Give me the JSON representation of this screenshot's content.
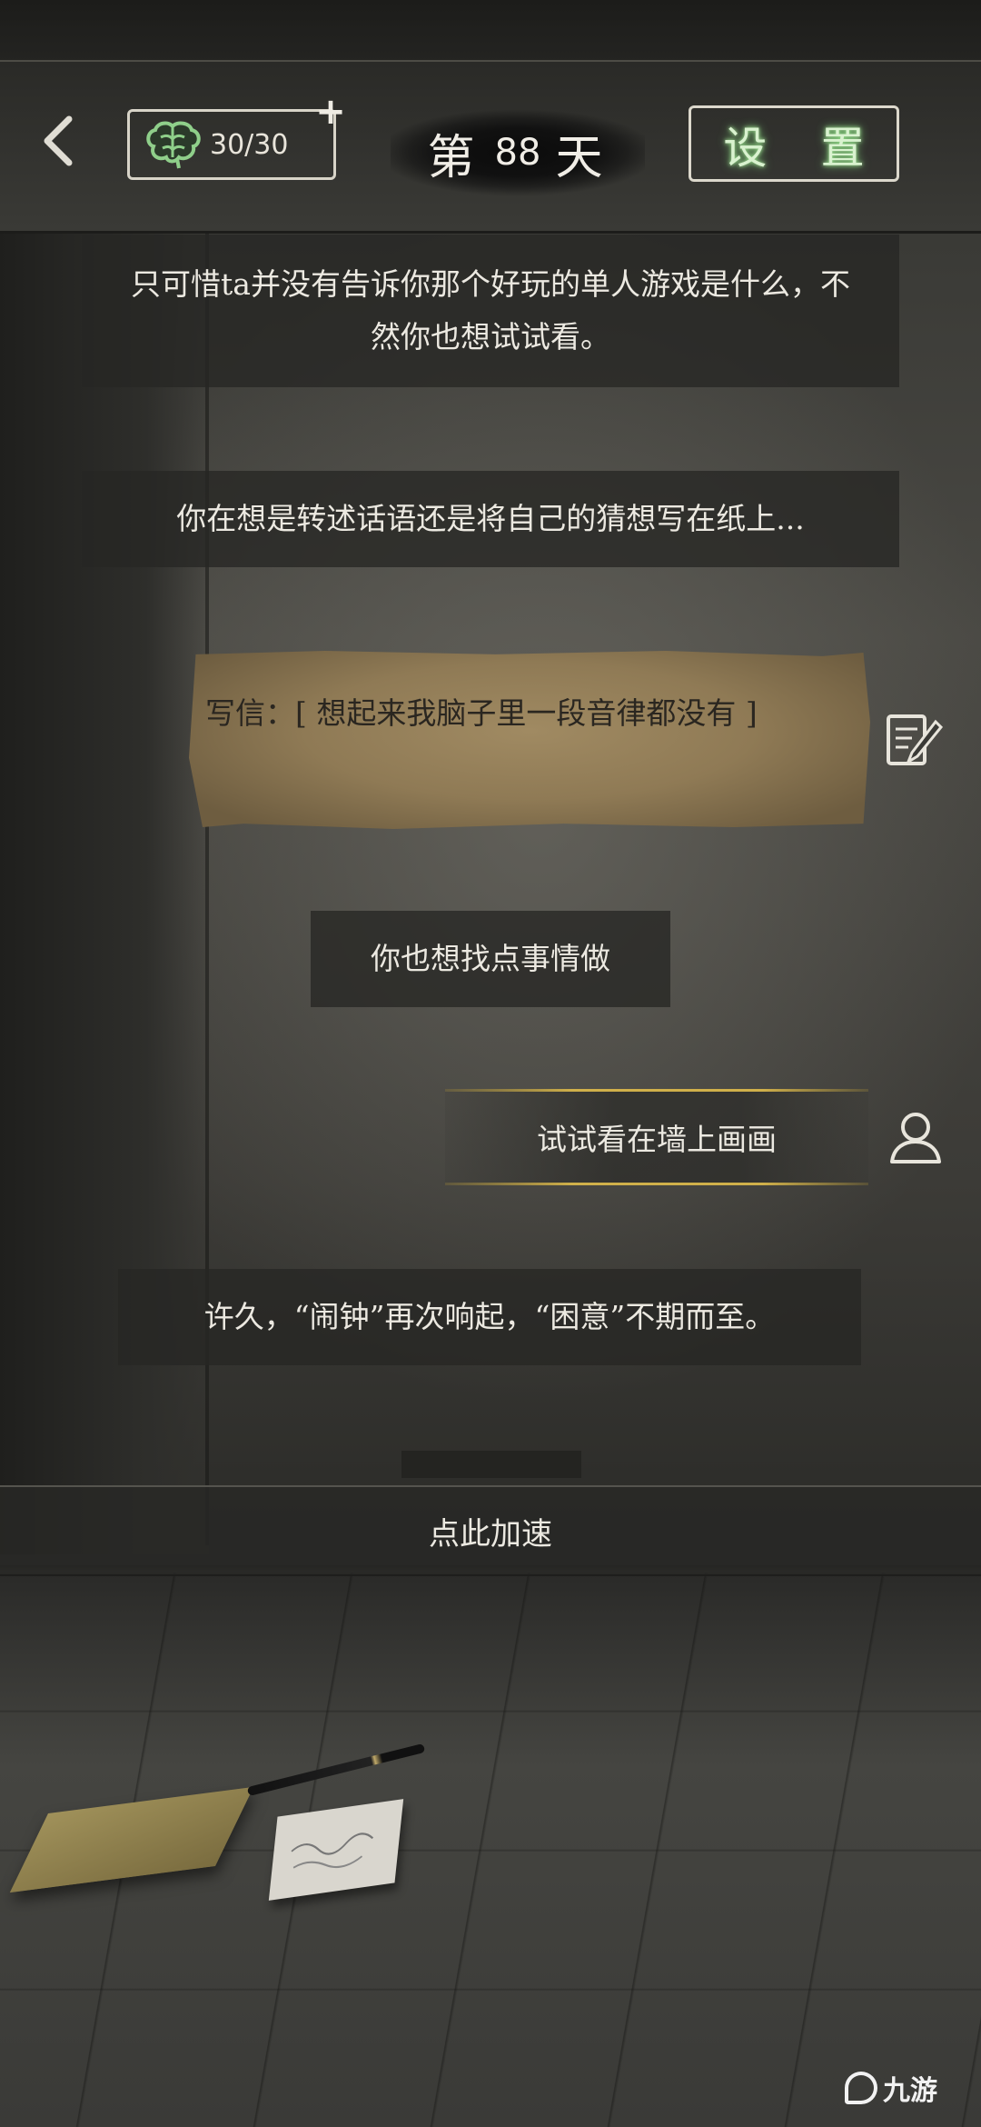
{
  "header": {
    "brain_count": "30/30",
    "day_prefix": "第",
    "day_number": "88",
    "day_suffix": "天",
    "settings_label": "设 置"
  },
  "messages": [
    "只可惜ta并没有告诉你那个好玩的单人游戏是什么，不然你也想试试看。",
    "你在想是转述话语还是将自己的猜想写在纸上...",
    "你也想找点事情做",
    "许久，“闹钟”再次响起，“困意”不期而至。"
  ],
  "letter": {
    "text": "写信：[ 想起来我脑子里一段音律都没有 ]"
  },
  "choice": {
    "text": "试试看在墙上画画"
  },
  "speed_up_label": "点此加速",
  "watermark_text": "九游",
  "icons": {
    "back": "chevron-left-icon",
    "brain": "brain-icon",
    "plus": "plus-icon",
    "write": "pen-paper-icon",
    "user": "user-icon"
  },
  "colors": {
    "settings_glow": "#7fd77a",
    "brain_icon": "#8fcf8a",
    "choice_line": "#d0b04a",
    "letter_paper": "#8f7a55"
  }
}
